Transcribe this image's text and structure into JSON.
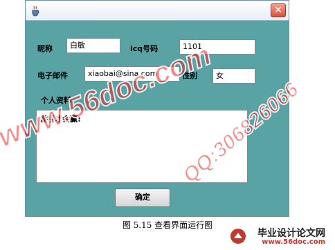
{
  "window": {
    "close_label": "✕",
    "labels": {
      "nickname": "昵称",
      "icq": "icq号码",
      "email": "电子邮件",
      "gender": "性别",
      "profile": "个人资料"
    },
    "fields": {
      "nickname": "白敏",
      "icq": "1101",
      "email": "xiaobai@sina.com",
      "gender": "女"
    },
    "profile_text": "爱拼才会赢!",
    "ok_label": "确定"
  },
  "caption": "图 5.15 查看界面运行图",
  "watermarks": {
    "site": "www.56doc.com",
    "qq": "QQ:306826066"
  },
  "footer_logo": {
    "title": "毕业设计论文网",
    "url": "www.56doc.com"
  },
  "colors": {
    "window_bg": "#5aa3a4",
    "watermark": "#e12828"
  }
}
